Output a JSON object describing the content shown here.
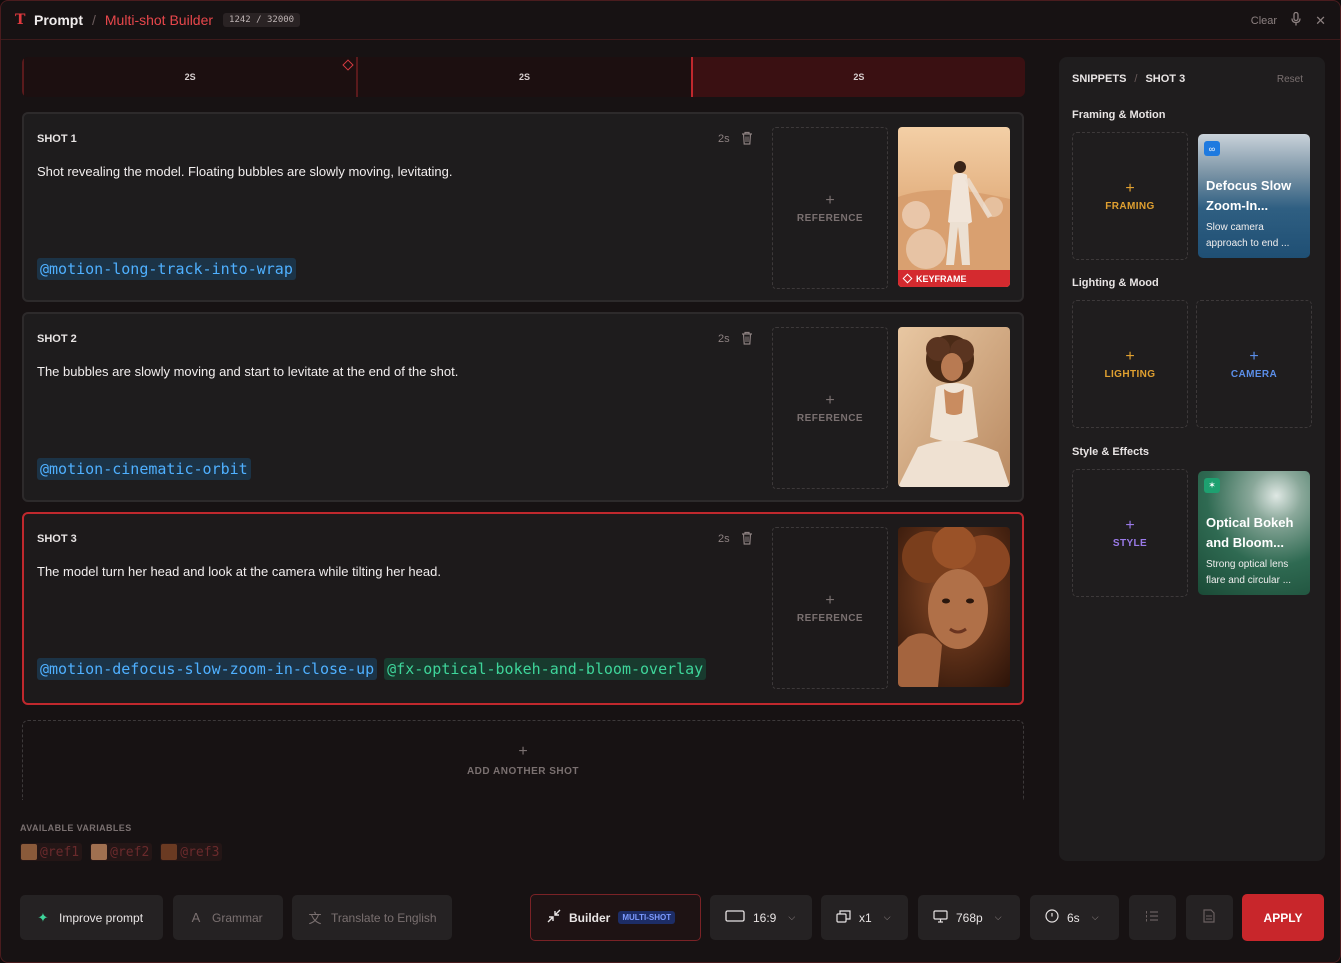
{
  "header": {
    "logo_glyph": "T",
    "breadcrumb_root": "Prompt",
    "breadcrumb_sep": "/",
    "breadcrumb_current": "Multi-shot Builder",
    "char_counter": "1242 / 32000",
    "clear_label": "Clear",
    "mic_icon": "microphone-icon",
    "close_glyph": "✕"
  },
  "timeline": {
    "segments": [
      {
        "label": "2S",
        "active": false
      },
      {
        "label": "2S",
        "active": false
      },
      {
        "label": "2S",
        "active": true
      }
    ]
  },
  "shots": [
    {
      "title": "SHOT 1",
      "duration": "2s",
      "text": "Shot revealing the model. Floating bubbles are slowly moving, levitating.",
      "tags": [
        {
          "text": "@motion-long-track-into-wrap",
          "kind": "motion"
        }
      ],
      "reference_label": "REFERENCE",
      "keyframe_label": "KEYFRAME"
    },
    {
      "title": "SHOT 2",
      "duration": "2s",
      "text": "The bubbles are slowly moving and start to levitate at the end of the shot.",
      "tags": [
        {
          "text": "@motion-cinematic-orbit",
          "kind": "motion"
        }
      ],
      "reference_label": "REFERENCE"
    },
    {
      "title": "SHOT 3",
      "duration": "2s",
      "text": "The model turn her head and look at the camera while tilting her head.",
      "tags": [
        {
          "text": "@motion-defocus-slow-zoom-in-close-up",
          "kind": "motion"
        },
        {
          "text": "@fx-optical-bokeh-and-bloom-overlay",
          "kind": "fx"
        }
      ],
      "reference_label": "REFERENCE"
    }
  ],
  "add_shot_label": "ADD ANOTHER SHOT",
  "variables": {
    "title": "AVAILABLE VARIABLES",
    "items": [
      "@ref1",
      "@ref2",
      "@ref3"
    ]
  },
  "snippets": {
    "title": "SNIPPETS",
    "sep": "/",
    "context": "SHOT 3",
    "reset_label": "Reset",
    "sections": [
      {
        "title": "Framing & Motion",
        "empty_label": "FRAMING",
        "card": {
          "title": "Defocus Slow Zoom-In...",
          "desc": "Slow camera approach to end ..."
        }
      },
      {
        "title": "Lighting & Mood",
        "empty_label": "LIGHTING",
        "second_empty_label": "CAMERA"
      },
      {
        "title": "Style & Effects",
        "empty_label": "STYLE",
        "card": {
          "title": "Optical Bokeh and Bloom...",
          "desc": "Strong optical lens flare and circular ..."
        }
      }
    ]
  },
  "footer": {
    "improve_label": "Improve prompt",
    "grammar_label": "Grammar",
    "translate_label": "Translate to English",
    "builder_label": "Builder",
    "builder_badge": "MULTI-SHOT",
    "aspect_label": "16:9",
    "count_label": "x1",
    "resolution_label": "768p",
    "duration_label": "6s",
    "apply_label": "APPLY"
  },
  "colors": {
    "accent": "#c8262b",
    "motion_tag": "#4fb0ff",
    "fx_tag": "#3ed59a",
    "framing": "#e0a030",
    "camera": "#5b8ee8",
    "style": "#9a7ae8"
  }
}
